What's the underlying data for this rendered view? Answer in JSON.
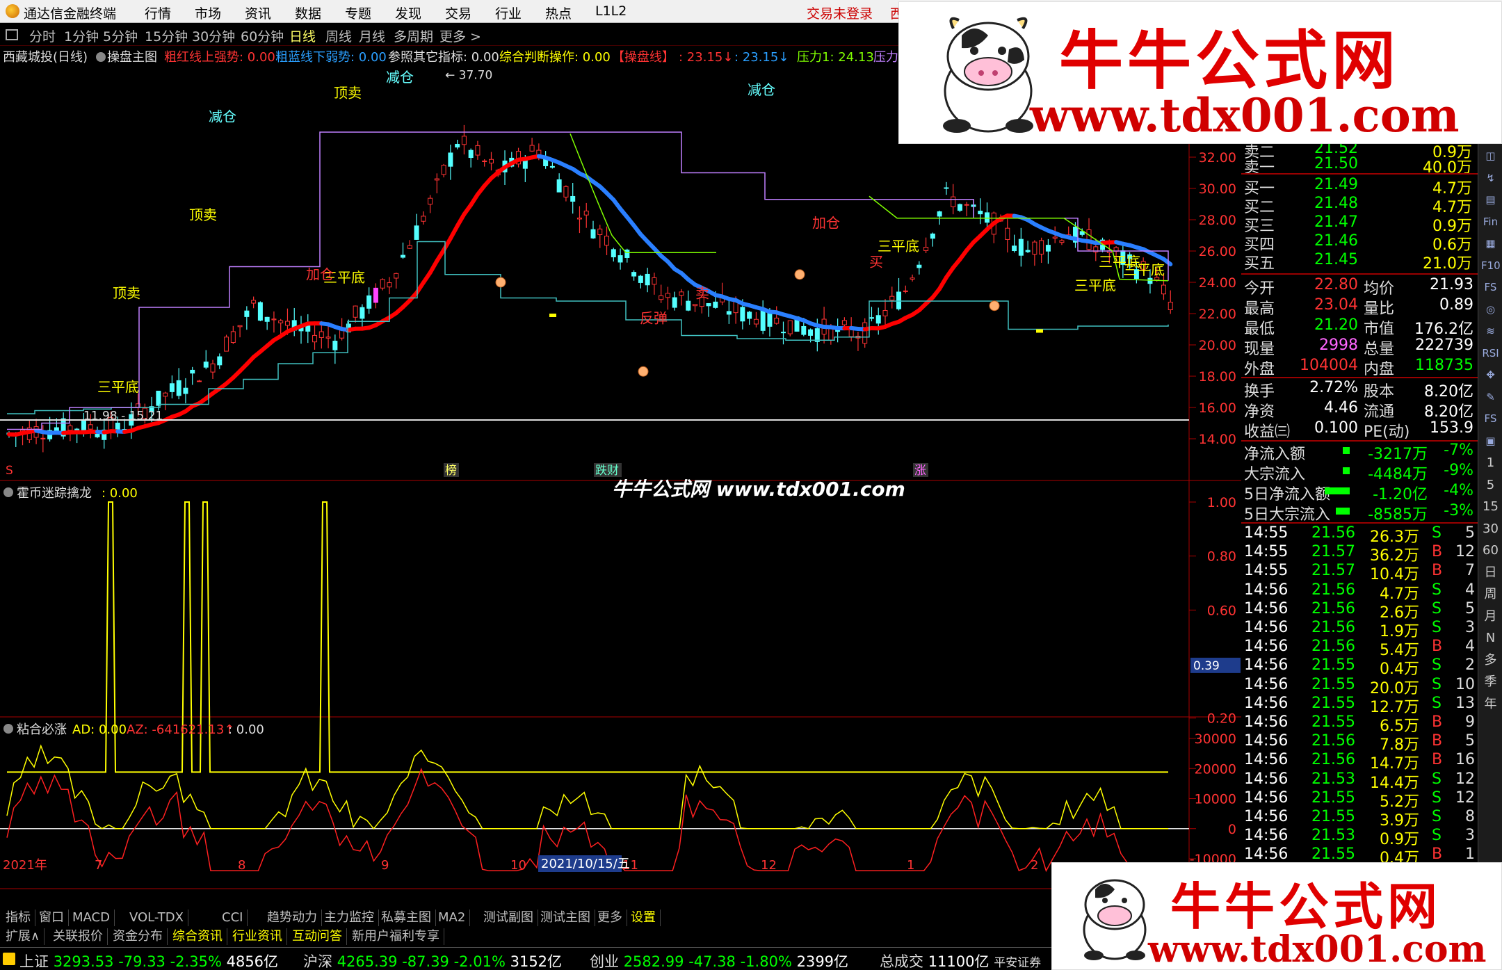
{
  "menubar": {
    "app_title": "通达信金融终端",
    "items": [
      "行情",
      "市场",
      "资讯",
      "数据",
      "专题",
      "发现",
      "交易",
      "行业",
      "热点",
      "L1L2"
    ],
    "trade_status": "交易未登录",
    "trade_status_suffix": "西"
  },
  "periods": [
    "分时",
    "1分钟",
    "5分钟",
    "15分钟",
    "30分钟",
    "60分钟",
    "日线",
    "周线",
    "月线",
    "多周期",
    "更多 >"
  ],
  "active_period": "日线",
  "main_chart": {
    "legend": {
      "stock": "西藏城投(日线)",
      "indicator": "操盘主图",
      "red_label": "粗红线上强势: 0.00",
      "blue_label": "粗蓝线下弱势: 0.00",
      "ref_label": "参照其它指标: 0.00",
      "judge_label": "综合判断操作: 0.00",
      "line_label": "【操盘线】",
      "red_value": ": 23.15↓",
      "blue_value": ": 23.15↓",
      "pressure1": "压力1: 24.13",
      "pressure2": "压力"
    },
    "high_label": "37.70",
    "low_label": "11.98 - 15.21",
    "price_ticks": [
      "32.00",
      "30.00",
      "28.00",
      "26.00",
      "24.00",
      "22.00",
      "20.00",
      "18.00",
      "16.00",
      "14.00"
    ],
    "signals": [
      {
        "text": "三平底",
        "color": "#ffff00"
      },
      {
        "text": "顶卖",
        "color": "#ffff00"
      },
      {
        "text": "顶卖",
        "color": "#ffff00"
      },
      {
        "text": "顶卖",
        "color": "#ffff00"
      },
      {
        "text": "三平底",
        "color": "#ffff00"
      },
      {
        "text": "三平底",
        "color": "#ffff00"
      },
      {
        "text": "三平底",
        "color": "#ffff00"
      },
      {
        "text": "三平底",
        "color": "#ffff00"
      },
      {
        "text": "三平底",
        "color": "#ffff00"
      },
      {
        "text": "加仓",
        "color": "#ff3333"
      },
      {
        "text": "加仓",
        "color": "#ff3333"
      },
      {
        "text": "反弹",
        "color": "#ff3333"
      },
      {
        "text": "减仓",
        "color": "#66ffff"
      },
      {
        "text": "减仓",
        "color": "#66ffff"
      },
      {
        "text": "减仓",
        "color": "#66ffff"
      },
      {
        "text": "卖",
        "color": "#ff3333"
      },
      {
        "text": "买",
        "color": "#ff3333"
      }
    ],
    "markers": [
      "S",
      "榜",
      "跌财",
      "涨"
    ]
  },
  "indicator1": {
    "title": "霍币迷踪擒龙",
    "value": ": 0.00",
    "ticks": [
      "1.00",
      "0.80",
      "0.60",
      "0.20"
    ],
    "cursor_value": "0.39"
  },
  "indicator2": {
    "title": "粘合必涨",
    "ad_label": "AD: 0.00",
    "az_label": "AZ: -641621.13↑",
    "extra": ": 0.00",
    "ticks": [
      "30000",
      "20000",
      "10000",
      "0",
      "-10000"
    ]
  },
  "time_axis": {
    "labels": [
      "2021年",
      "7",
      "8",
      "9",
      "10",
      "11",
      "12",
      "1",
      "2"
    ],
    "cursor_date": "2021/10/15/五"
  },
  "bottom_tabs": [
    "指标",
    "窗口",
    "MACD",
    "VOL-TDX",
    "CCI",
    "趋势动力",
    "主力监控",
    "私募主图",
    "MA2",
    "测试副图",
    "测试主图",
    "更多",
    "设置"
  ],
  "ext_tabs": [
    "扩展∧",
    "关联报价",
    "资金分布",
    "综合资讯",
    "行业资讯",
    "互动问答",
    "新用户福利专享"
  ],
  "statusbar": {
    "sh_label": "上证",
    "sh_value": "3293.53",
    "sh_change": "-79.33",
    "sh_pct": "-2.35%",
    "sh_amount": "4856亿",
    "hs_label": "沪深",
    "hs_value": "4265.39",
    "hs_change": "-87.39",
    "hs_pct": "-2.01%",
    "hs_amount": "3152亿",
    "cy_label": "创业",
    "cy_value": "2582.99",
    "cy_change": "-47.38",
    "cy_pct": "-1.80%",
    "cy_amount": "2399亿",
    "total_label": "总成交",
    "total_value": "11100亿",
    "broker": "平安证券"
  },
  "quote": {
    "order_book": [
      {
        "label": "卖二",
        "price": "21.52",
        "vol": "0.9万"
      },
      {
        "label": "卖一",
        "price": "21.50",
        "vol": "40.0万"
      },
      {
        "label": "买一",
        "price": "21.49",
        "vol": "4.7万"
      },
      {
        "label": "买二",
        "price": "21.48",
        "vol": "4.7万"
      },
      {
        "label": "买三",
        "price": "21.47",
        "vol": "0.9万"
      },
      {
        "label": "买四",
        "price": "21.46",
        "vol": "0.6万"
      },
      {
        "label": "买五",
        "price": "21.45",
        "vol": "21.0万"
      }
    ],
    "stats": [
      {
        "l1": "今开",
        "v1": "22.80",
        "c1": "#ff3333",
        "l2": "均价",
        "v2": "21.93",
        "c2": "#ffffff"
      },
      {
        "l1": "最高",
        "v1": "23.04",
        "c1": "#ff3333",
        "l2": "量比",
        "v2": "0.89",
        "c2": "#ffffff"
      },
      {
        "l1": "最低",
        "v1": "21.20",
        "c1": "#00ff00",
        "l2": "市值",
        "v2": "176.2亿",
        "c2": "#ffffff"
      },
      {
        "l1": "现量",
        "v1": "2998",
        "c1": "#ff66ff",
        "l2": "总量",
        "v2": "222739",
        "c2": "#ffffff"
      },
      {
        "l1": "外盘",
        "v1": "104004",
        "c1": "#ff3333",
        "l2": "内盘",
        "v2": "118735",
        "c2": "#00ff00"
      }
    ],
    "stats2": [
      {
        "l1": "换手",
        "v1": "2.72%",
        "l2": "股本",
        "v2": "8.20亿"
      },
      {
        "l1": "净资",
        "v1": "4.46",
        "l2": "流通",
        "v2": "8.20亿"
      },
      {
        "l1": "收益㈢",
        "v1": "0.100",
        "l2": "PE(动)",
        "v2": "153.9"
      }
    ],
    "flows": [
      {
        "label": "净流入额",
        "value": "-3217万",
        "pct": "-7%"
      },
      {
        "label": "大宗流入",
        "value": "-4484万",
        "pct": "-9%"
      },
      {
        "label": "5日净流入额",
        "value": "-1.20亿",
        "pct": "-4%"
      },
      {
        "label": "5日大宗流入",
        "value": "-8585万",
        "pct": "-3%"
      }
    ],
    "ticks": [
      {
        "time": "14:55",
        "price": "21.56",
        "vol": "26.3万",
        "side": "S",
        "n": "5"
      },
      {
        "time": "14:55",
        "price": "21.57",
        "vol": "36.2万",
        "side": "B",
        "n": "12"
      },
      {
        "time": "14:55",
        "price": "21.57",
        "vol": "10.4万",
        "side": "B",
        "n": "7"
      },
      {
        "time": "14:56",
        "price": "21.56",
        "vol": "4.7万",
        "side": "S",
        "n": "4"
      },
      {
        "time": "14:56",
        "price": "21.56",
        "vol": "2.6万",
        "side": "S",
        "n": "5"
      },
      {
        "time": "14:56",
        "price": "21.56",
        "vol": "1.9万",
        "side": "S",
        "n": "3"
      },
      {
        "time": "14:56",
        "price": "21.56",
        "vol": "5.4万",
        "side": "B",
        "n": "4"
      },
      {
        "time": "14:56",
        "price": "21.55",
        "vol": "0.4万",
        "side": "S",
        "n": "2"
      },
      {
        "time": "14:56",
        "price": "21.55",
        "vol": "20.0万",
        "side": "S",
        "n": "10"
      },
      {
        "time": "14:56",
        "price": "21.55",
        "vol": "12.7万",
        "side": "S",
        "n": "13"
      },
      {
        "time": "14:56",
        "price": "21.55",
        "vol": "6.5万",
        "side": "B",
        "n": "9"
      },
      {
        "time": "14:56",
        "price": "21.56",
        "vol": "7.8万",
        "side": "B",
        "n": "5"
      },
      {
        "time": "14:56",
        "price": "21.56",
        "vol": "14.7万",
        "side": "B",
        "n": "16"
      },
      {
        "time": "14:56",
        "price": "21.53",
        "vol": "14.4万",
        "side": "S",
        "n": "12"
      },
      {
        "time": "14:56",
        "price": "21.55",
        "vol": "5.2万",
        "side": "S",
        "n": "12"
      },
      {
        "time": "14:56",
        "price": "21.55",
        "vol": "3.9万",
        "side": "S",
        "n": "8"
      },
      {
        "time": "14:56",
        "price": "21.53",
        "vol": "0.9万",
        "side": "S",
        "n": "3"
      },
      {
        "time": "14:56",
        "price": "21.55",
        "vol": "0.4万",
        "side": "B",
        "n": "1"
      }
    ]
  },
  "right_toolbar": [
    "◫",
    "↯",
    "▤",
    "Fin",
    "▦",
    "F10",
    "FS",
    "◎",
    "≋",
    "RSI",
    "✥",
    "✎",
    "FS",
    "▣",
    "1",
    "5",
    "15",
    "30",
    "60",
    "日",
    "周",
    "月",
    "N",
    "多",
    "季",
    "年"
  ],
  "watermark": {
    "title": "牛牛公式网",
    "url": "www.tdx001.com",
    "center_text": "牛牛公式网 www.tdx001.com"
  },
  "colors": {
    "up": "#ff3333",
    "down": "#54ffff",
    "red_line": "#ff0000",
    "blue_line": "#2a7fff",
    "purple_line": "#c080ff",
    "green_line": "#80ff00",
    "cyan_line": "#40c0c0",
    "yellow": "#ffff00"
  }
}
